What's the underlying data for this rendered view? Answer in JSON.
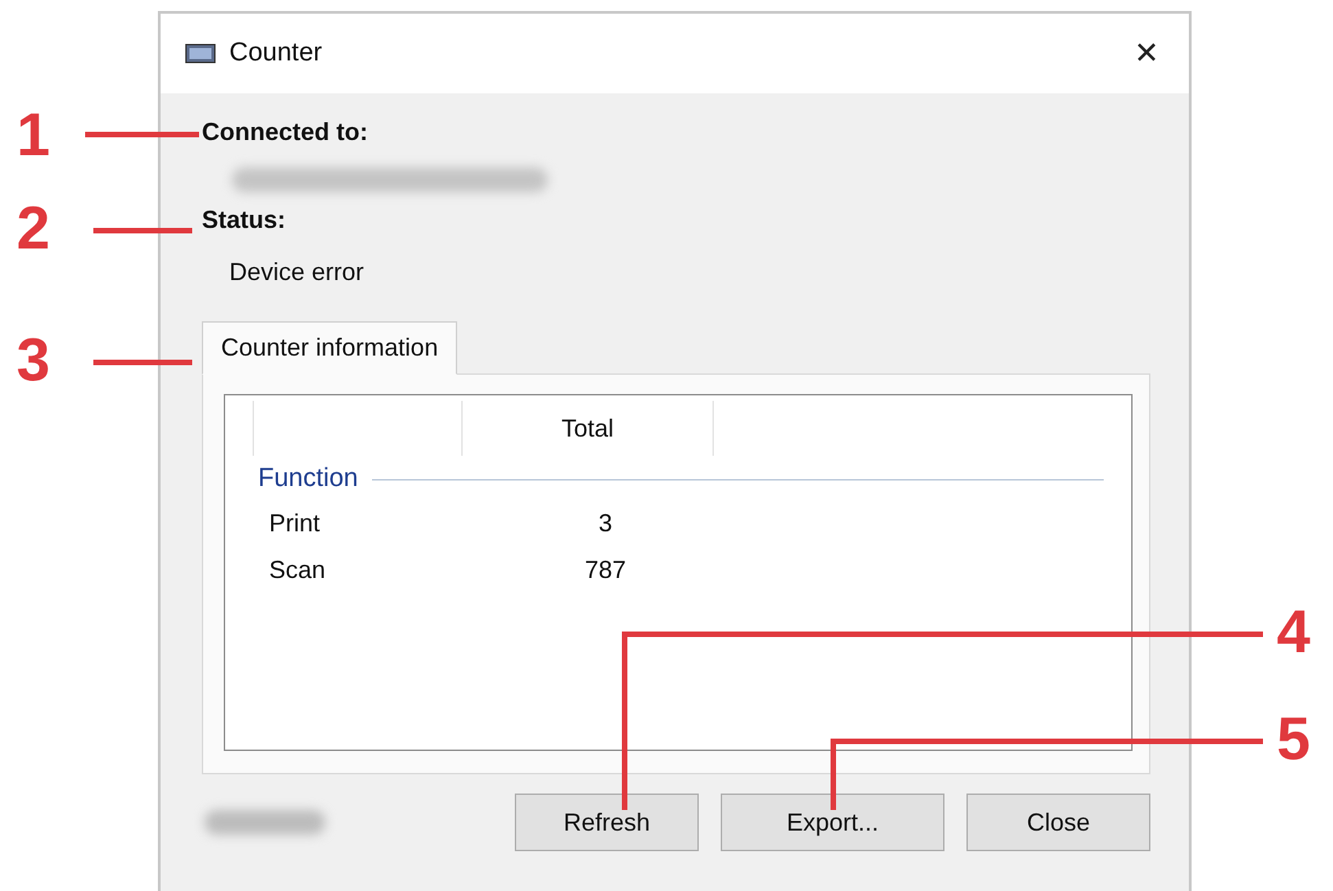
{
  "window": {
    "title": "Counter",
    "close": "✕"
  },
  "connected_label": "Connected to:",
  "status_label": "Status:",
  "status_value": "Device error",
  "tabs": [
    {
      "label": "Counter information",
      "selected": true
    }
  ],
  "table": {
    "total_header": "Total",
    "groups": [
      {
        "label": "Function",
        "rows": [
          {
            "name": "Print",
            "total": "3"
          },
          {
            "name": "Scan",
            "total": "787"
          }
        ]
      }
    ]
  },
  "buttons": [
    "Refresh",
    "Export...",
    "Close"
  ],
  "callouts": [
    "1",
    "2",
    "3",
    "4",
    "5"
  ]
}
